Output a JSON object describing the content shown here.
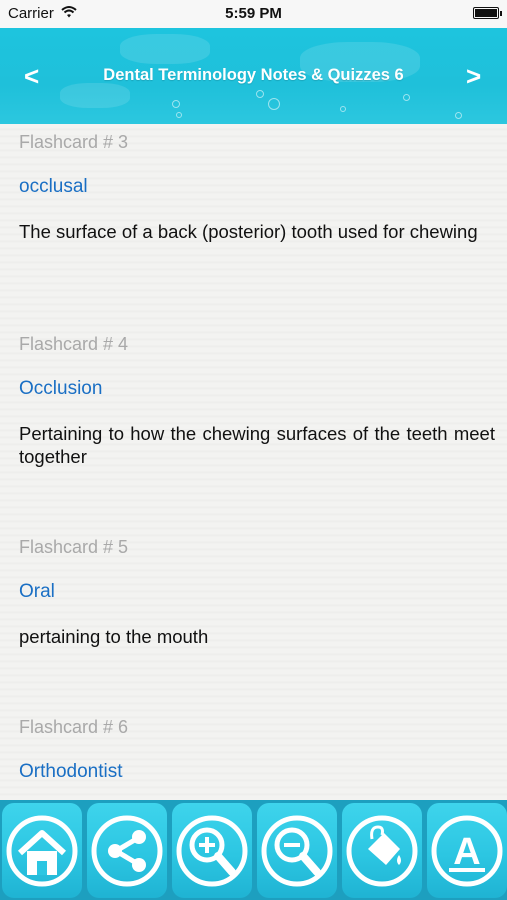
{
  "status_bar": {
    "carrier": "Carrier",
    "time": "5:59 PM"
  },
  "nav": {
    "title": "Dental Terminology Notes & Quizzes 6",
    "prev_label": "<",
    "next_label": ">"
  },
  "flashcards": [
    {
      "number_label": "Flashcard # 3",
      "term": "occlusal",
      "definition": "The surface of a back (posterior) tooth used for chewing"
    },
    {
      "number_label": "Flashcard # 4",
      "term": "Occlusion",
      "definition": "Pertaining to how the chewing surfaces of the teeth meet together"
    },
    {
      "number_label": "Flashcard # 5",
      "term": "Oral",
      "definition": "pertaining to the mouth"
    },
    {
      "number_label": "Flashcard # 6",
      "term": "Orthodontist",
      "definition": ""
    }
  ],
  "toolbar": {
    "buttons": [
      {
        "icon": "home-icon"
      },
      {
        "icon": "share-icon"
      },
      {
        "icon": "zoom-in-icon"
      },
      {
        "icon": "zoom-out-icon"
      },
      {
        "icon": "paint-bucket-icon"
      },
      {
        "icon": "font-icon",
        "glyph": "A"
      }
    ]
  },
  "colors": {
    "nav_bg": "#1ec4de",
    "term_blue": "#1a6fc4",
    "card_number_gray": "#a9a9a9",
    "toolbar_bg": "#1d9fbf",
    "button_face": "#2cc6e2"
  }
}
